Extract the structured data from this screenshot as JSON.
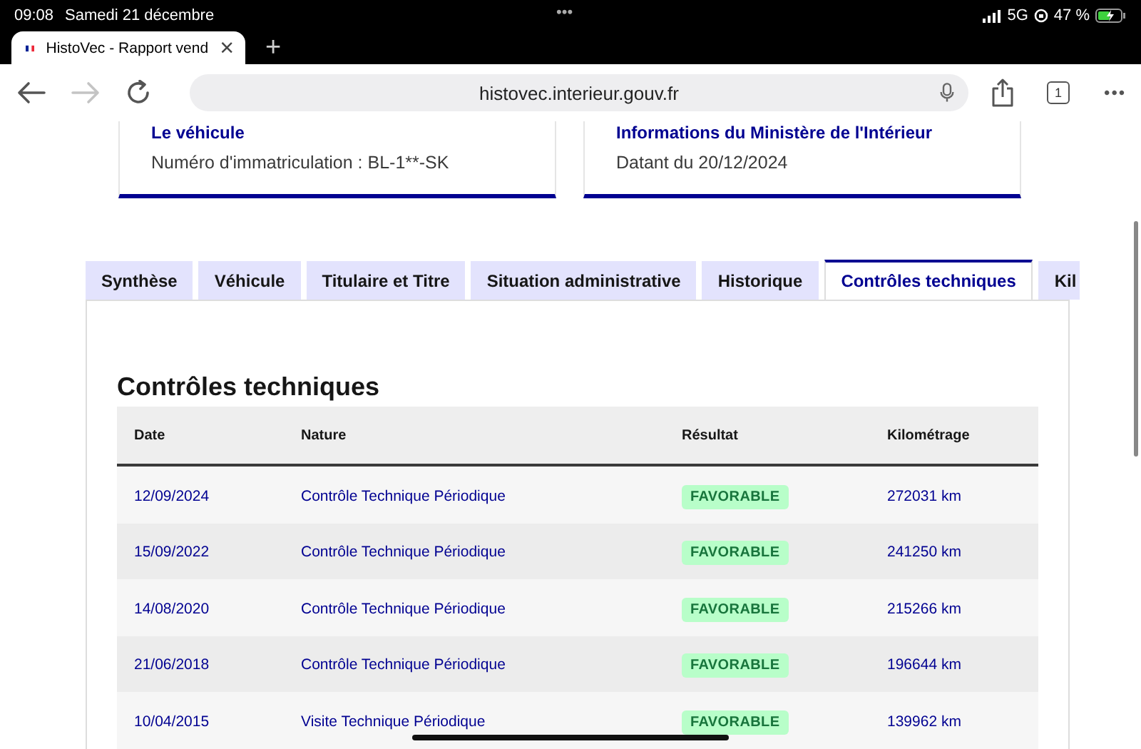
{
  "status_bar": {
    "time": "09:08",
    "date": "Samedi 21 décembre",
    "dots": "•••",
    "network": "5G",
    "battery": "47 %"
  },
  "browser": {
    "tab_title": "HistoVec - Rapport vend",
    "close": "×",
    "new_tab": "+",
    "url": "histovec.interieur.gouv.fr",
    "tab_count": "1",
    "more": "•••",
    "forward_disabled": true
  },
  "cards": [
    {
      "title": "Le véhicule",
      "text": "Numéro d'immatriculation : BL-1**-SK"
    },
    {
      "title": "Informations du Ministère de l'Intérieur",
      "text": "Datant du 20/12/2024"
    }
  ],
  "tabs": [
    {
      "label": "Synthèse",
      "selected": false
    },
    {
      "label": "Véhicule",
      "selected": false
    },
    {
      "label": "Titulaire et Titre",
      "selected": false
    },
    {
      "label": "Situation administrative",
      "selected": false
    },
    {
      "label": "Historique",
      "selected": false
    },
    {
      "label": "Contrôles techniques",
      "selected": true
    },
    {
      "label": "Kil",
      "selected": false
    }
  ],
  "section_title": "Contrôles techniques",
  "table": {
    "columns": [
      "Date",
      "Nature",
      "Résultat",
      "Kilométrage"
    ],
    "rows": [
      {
        "date": "12/09/2024",
        "nature": "Contrôle Technique Périodique",
        "result": "FAVORABLE",
        "mileage": "272031 km"
      },
      {
        "date": "15/09/2022",
        "nature": "Contrôle Technique Périodique",
        "result": "FAVORABLE",
        "mileage": "241250 km"
      },
      {
        "date": "14/08/2020",
        "nature": "Contrôle Technique Périodique",
        "result": "FAVORABLE",
        "mileage": "215266 km"
      },
      {
        "date": "21/06/2018",
        "nature": "Contrôle Technique Périodique",
        "result": "FAVORABLE",
        "mileage": "196644 km"
      },
      {
        "date": "10/04/2015",
        "nature": "Visite Technique Périodique",
        "result": "FAVORABLE",
        "mileage": "139962 km"
      }
    ]
  }
}
